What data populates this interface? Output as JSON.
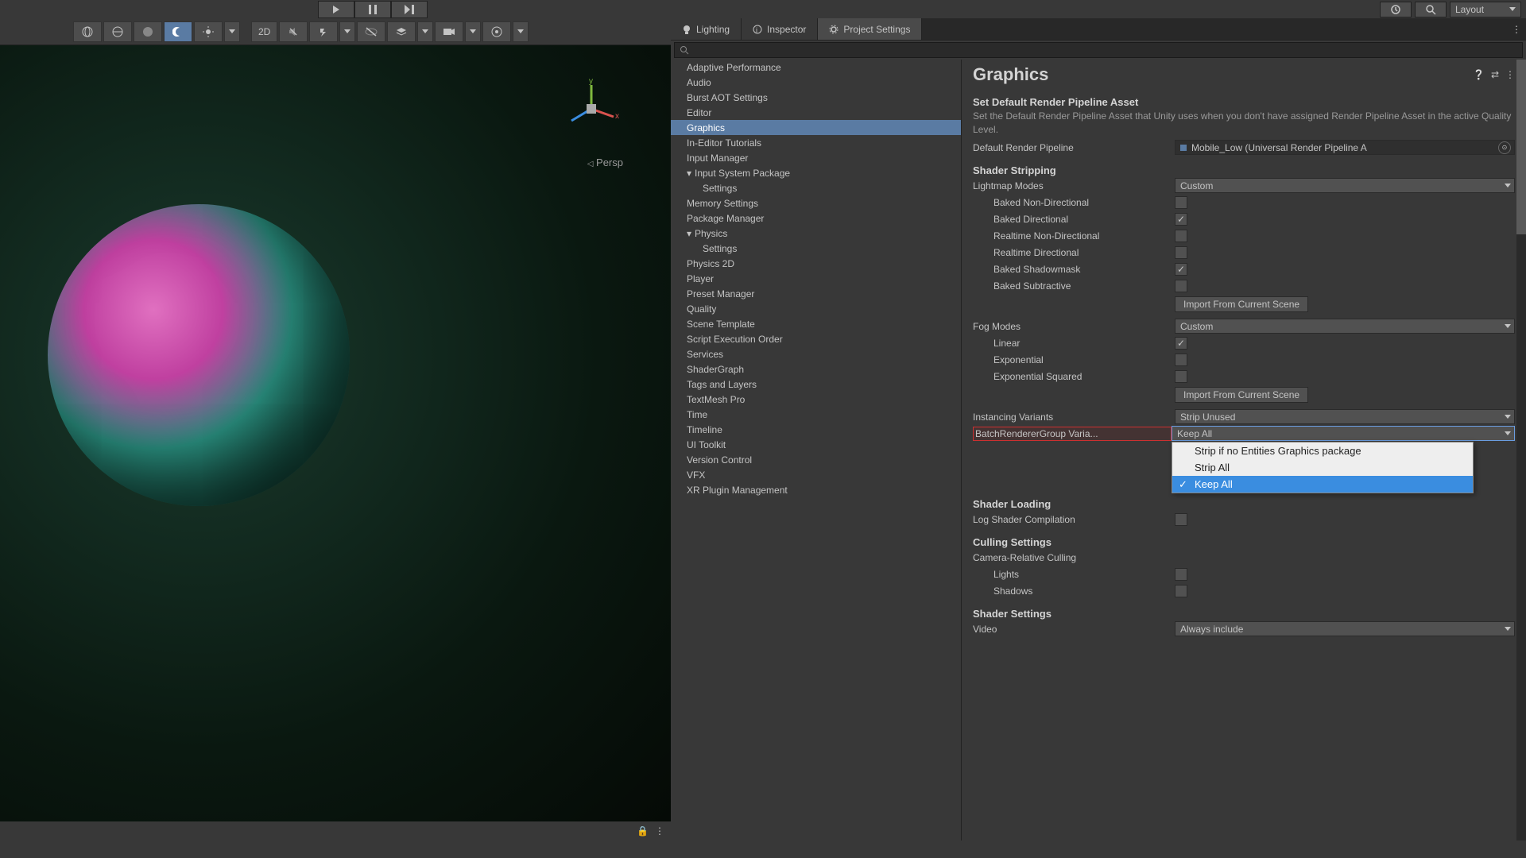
{
  "topbar": {
    "layout_label": "Layout"
  },
  "tabs": {
    "lighting": "Lighting",
    "inspector": "Inspector",
    "project_settings": "Project Settings"
  },
  "nav": {
    "items": [
      "Adaptive Performance",
      "Audio",
      "Burst AOT Settings",
      "Editor",
      "Graphics",
      "In-Editor Tutorials",
      "Input Manager",
      "Input System Package",
      "Settings",
      "Memory Settings",
      "Package Manager",
      "Physics",
      "Settings",
      "Physics 2D",
      "Player",
      "Preset Manager",
      "Quality",
      "Scene Template",
      "Script Execution Order",
      "Services",
      "ShaderGraph",
      "Tags and Layers",
      "TextMesh Pro",
      "Time",
      "Timeline",
      "UI Toolkit",
      "Version Control",
      "VFX",
      "XR Plugin Management"
    ]
  },
  "content": {
    "title": "Graphics",
    "rp_section": "Set Default Render Pipeline Asset",
    "rp_desc": "Set the Default Render Pipeline Asset that Unity uses when you don't have assigned Render Pipeline Asset in the active Quality Level.",
    "rp_label": "Default Render Pipeline",
    "rp_value": "Mobile_Low (Universal Render Pipeline A",
    "shader_stripping": "Shader Stripping",
    "lightmap_modes": "Lightmap Modes",
    "lightmap_value": "Custom",
    "baked_nondir": "Baked Non-Directional",
    "baked_dir": "Baked Directional",
    "realtime_nondir": "Realtime Non-Directional",
    "realtime_dir": "Realtime Directional",
    "baked_shadowmask": "Baked Shadowmask",
    "baked_subtractive": "Baked Subtractive",
    "import_btn": "Import From Current Scene",
    "fog_modes": "Fog Modes",
    "fog_value": "Custom",
    "linear": "Linear",
    "exponential": "Exponential",
    "exp_squared": "Exponential Squared",
    "instancing": "Instancing Variants",
    "instancing_value": "Strip Unused",
    "brg": "BatchRendererGroup Varia...",
    "brg_value": "Keep All",
    "brg_options": {
      "strip_no_entities": "Strip if no Entities Graphics package",
      "strip_all": "Strip All",
      "keep_all": "Keep All"
    },
    "shader_loading": "Shader Loading",
    "log_shader": "Log Shader Compilation",
    "culling": "Culling Settings",
    "camera_culling": "Camera-Relative Culling",
    "lights": "Lights",
    "shadows": "Shadows",
    "shader_settings": "Shader Settings",
    "video": "Video",
    "video_value": "Always include"
  },
  "scene": {
    "persp": "Persp",
    "mode_2d": "2D"
  }
}
